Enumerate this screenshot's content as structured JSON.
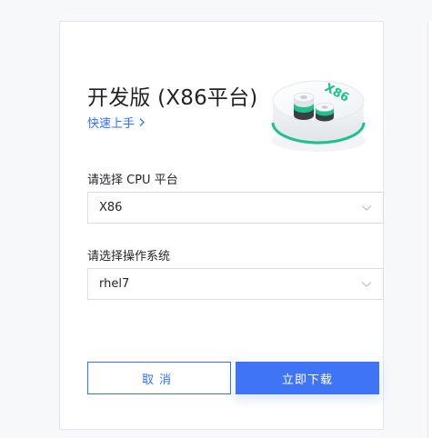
{
  "dialog": {
    "title": "开发版 (X86平台)",
    "quickstart_link": "快速上手",
    "illustration_label": "X86"
  },
  "cpu_select": {
    "label": "请选择 CPU 平台",
    "value": "X86"
  },
  "os_select": {
    "label": "请选择操作系统",
    "value": "rhel7"
  },
  "actions": {
    "cancel_label": "取消",
    "download_label": "立即下载"
  },
  "colors": {
    "accent": "#3370ff",
    "primary_button": "#3f74f6",
    "illustration_green": "#1fc18b"
  }
}
